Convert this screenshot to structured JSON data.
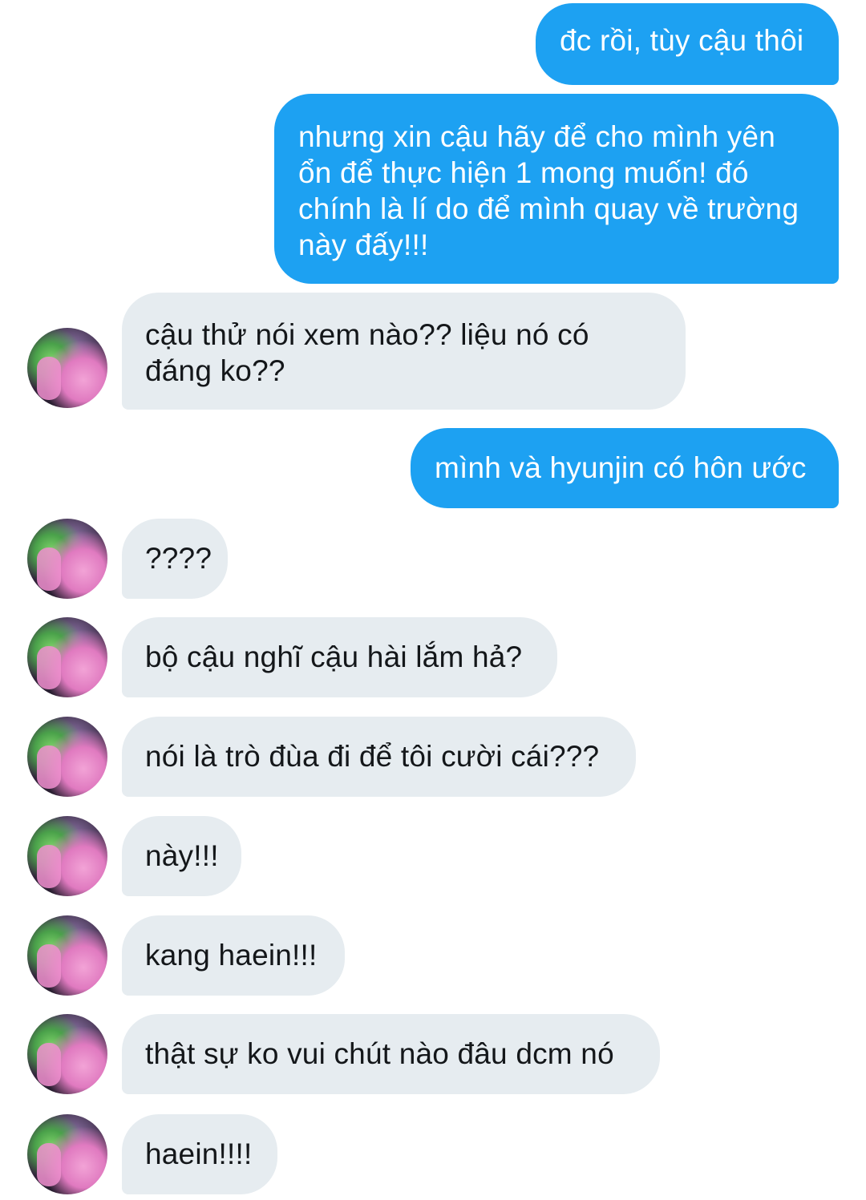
{
  "messages": [
    {
      "side": "sent",
      "text": "đc rồi, tùy cậu thôi"
    },
    {
      "side": "sent",
      "lines": [
        "nhưng xin cậu hãy để cho mình yên",
        "ổn để thực hiện 1 mong muốn! đó",
        "chính là lí do để mình quay về trường",
        "này đấy!!!"
      ]
    },
    {
      "side": "received",
      "lines": [
        "cậu thử nói xem nào?? liệu nó có",
        "đáng ko??"
      ],
      "avatar": "profile-avatar"
    },
    {
      "side": "sent",
      "text": "mình và hyunjin có hôn ước"
    },
    {
      "side": "received",
      "text": "????",
      "avatar": "profile-avatar"
    },
    {
      "side": "received",
      "text": "bộ cậu nghĩ cậu hài lắm hả?",
      "avatar": "profile-avatar"
    },
    {
      "side": "received",
      "text": "nói là trò đùa đi để tôi cười cái???",
      "avatar": "profile-avatar"
    },
    {
      "side": "received",
      "text": "này!!!",
      "avatar": "profile-avatar"
    },
    {
      "side": "received",
      "text": "kang haein!!!",
      "avatar": "profile-avatar"
    },
    {
      "side": "received",
      "text": "thật sự ko vui chút nào đâu dcm nó",
      "avatar": "profile-avatar"
    },
    {
      "side": "received",
      "text": "haein!!!!",
      "avatar": "profile-avatar"
    }
  ],
  "colors": {
    "sent_bubble": "#1da1f2",
    "received_bubble": "#e6ecf0",
    "sent_text": "#ffffff",
    "received_text": "#14171a"
  }
}
